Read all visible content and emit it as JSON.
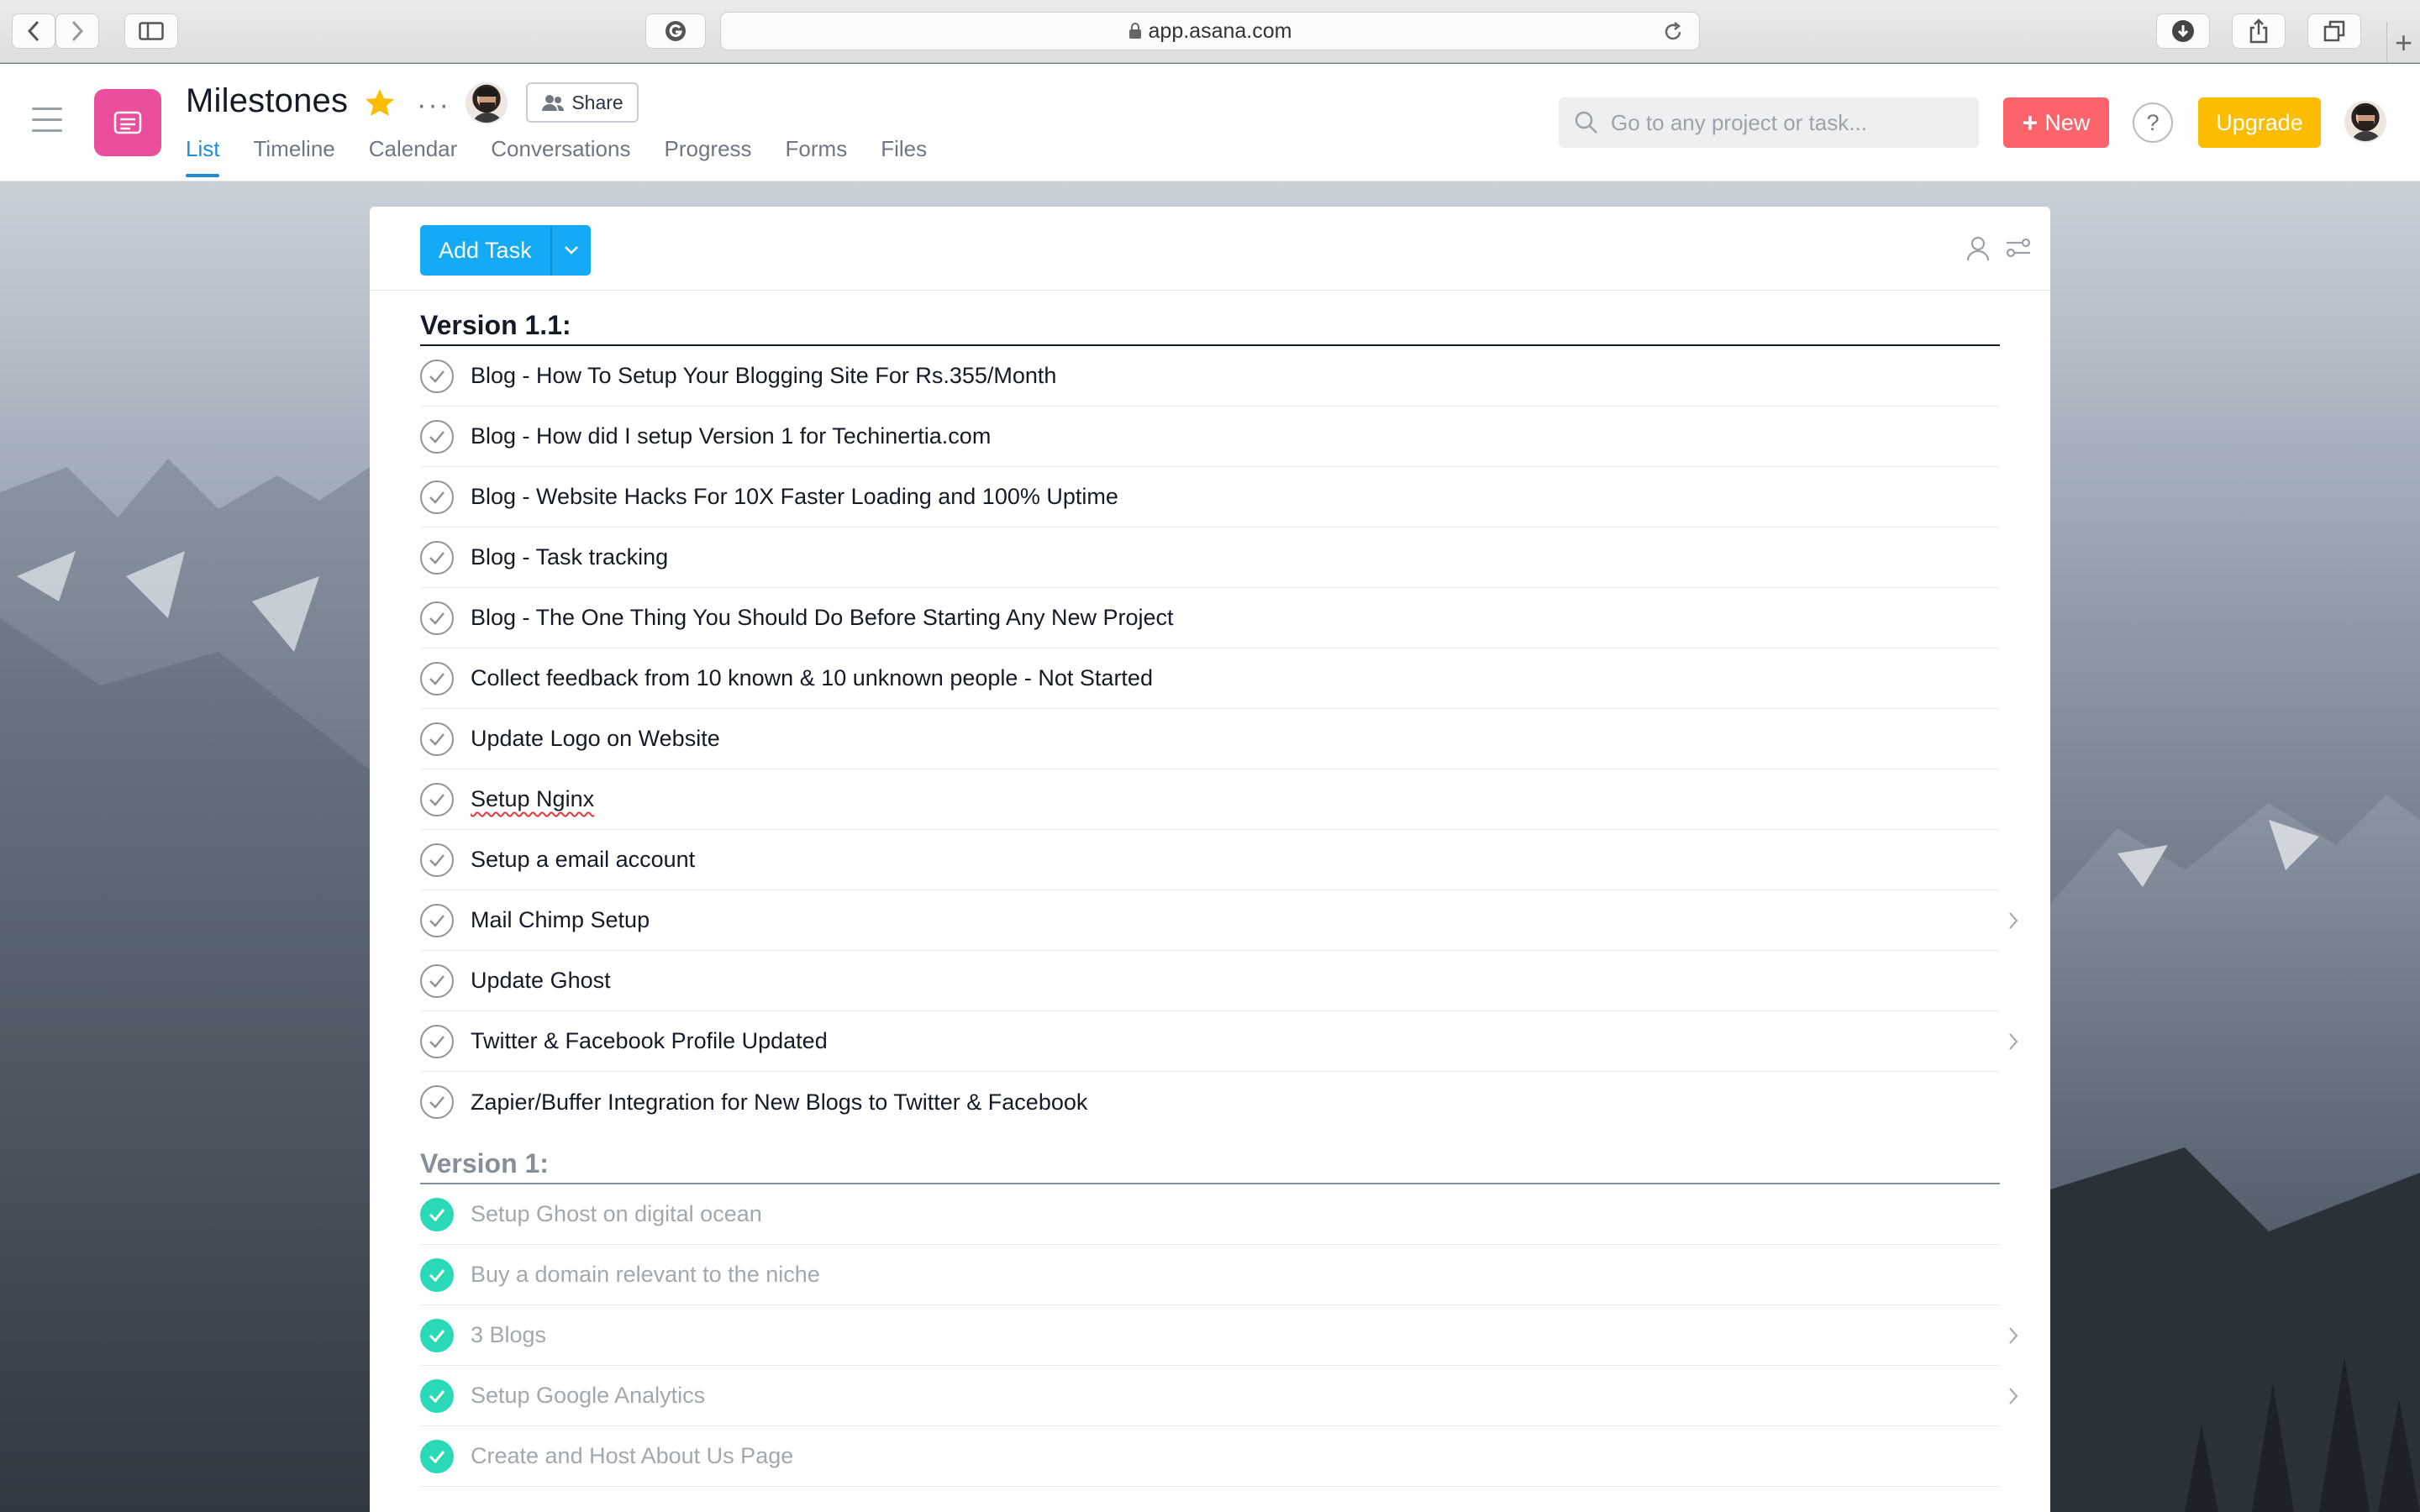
{
  "browser": {
    "url": "app.asana.com"
  },
  "header": {
    "project_title": "Milestones",
    "share_label": "Share",
    "tabs": [
      {
        "label": "List",
        "active": true
      },
      {
        "label": "Timeline",
        "active": false
      },
      {
        "label": "Calendar",
        "active": false
      },
      {
        "label": "Conversations",
        "active": false
      },
      {
        "label": "Progress",
        "active": false
      },
      {
        "label": "Forms",
        "active": false
      },
      {
        "label": "Files",
        "active": false
      }
    ],
    "search_placeholder": "Go to any project or task...",
    "new_label": "New",
    "help_label": "?",
    "upgrade_label": "Upgrade"
  },
  "toolbar": {
    "add_task_label": "Add Task"
  },
  "sections": [
    {
      "title": "Version 1.1:",
      "completed": false,
      "tasks": [
        {
          "name": "Blog - How To Setup Your Blogging Site For Rs.355/Month",
          "done": false,
          "has_subtasks": false
        },
        {
          "name": "Blog - How did I setup Version 1 for Techinertia.com",
          "done": false,
          "has_subtasks": false
        },
        {
          "name": "Blog - Website Hacks For 10X Faster Loading and 100% Uptime",
          "done": false,
          "has_subtasks": false
        },
        {
          "name": "Blog - Task tracking",
          "done": false,
          "has_subtasks": false
        },
        {
          "name": "Blog - The One Thing You Should Do Before Starting Any New Project",
          "done": false,
          "has_subtasks": false
        },
        {
          "name": "Collect feedback from 10 known & 10 unknown people - Not Started",
          "done": false,
          "has_subtasks": false
        },
        {
          "name": "Update Logo on Website",
          "done": false,
          "has_subtasks": false
        },
        {
          "name": "Setup Nginx",
          "done": false,
          "has_subtasks": false
        },
        {
          "name": "Setup a email account",
          "done": false,
          "has_subtasks": false
        },
        {
          "name": "Mail Chimp Setup",
          "done": false,
          "has_subtasks": true
        },
        {
          "name": "Update Ghost",
          "done": false,
          "has_subtasks": false
        },
        {
          "name": "Twitter & Facebook Profile Updated",
          "done": false,
          "has_subtasks": true
        },
        {
          "name": "Zapier/Buffer Integration for New Blogs to Twitter & Facebook",
          "done": false,
          "has_subtasks": false
        }
      ]
    },
    {
      "title": "Version 1:",
      "completed": true,
      "tasks": [
        {
          "name": "Setup Ghost on digital ocean",
          "done": true,
          "has_subtasks": false
        },
        {
          "name": "Buy a domain relevant to the niche",
          "done": true,
          "has_subtasks": false
        },
        {
          "name": "3 Blogs",
          "done": true,
          "has_subtasks": true
        },
        {
          "name": "Setup Google Analytics",
          "done": true,
          "has_subtasks": true
        },
        {
          "name": "Create and Host About Us Page",
          "done": true,
          "has_subtasks": false
        }
      ]
    }
  ],
  "colors": {
    "brand_pink": "#ea4e9d",
    "accent_blue": "#14aaf5",
    "new_red": "#fc636b",
    "upgrade_yellow": "#fcbd01",
    "done_green": "#2ad9b5"
  },
  "icons": {
    "back": "chevron-left-icon",
    "forward": "chevron-right-icon",
    "sidebar": "sidebar-icon",
    "grammarly": "grammarly-icon",
    "lock": "lock-icon",
    "reload": "reload-icon",
    "download": "download-icon",
    "share": "share-icon",
    "tabs": "tabs-icon",
    "menu": "hamburger-icon",
    "project": "list-icon",
    "favorite": "star-icon",
    "more": "more-icon",
    "people": "people-icon",
    "search": "search-icon",
    "assignee_filter": "person-icon",
    "customize": "sliders-icon",
    "complete": "check-icon",
    "subtasks": "chevron-right-icon"
  }
}
